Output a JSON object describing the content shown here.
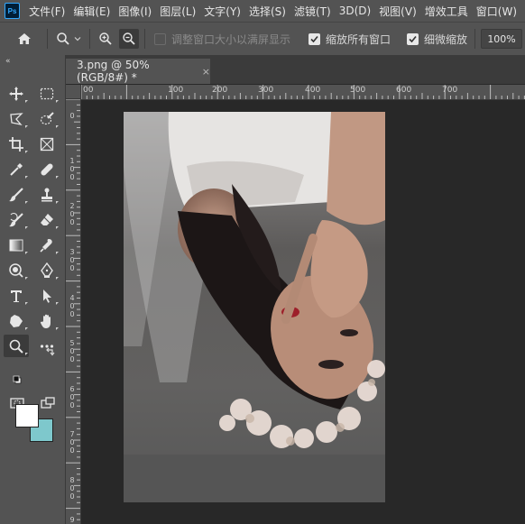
{
  "app": {
    "logo_text": "Ps"
  },
  "menu": [
    "文件(F)",
    "编辑(E)",
    "图像(I)",
    "图层(L)",
    "文字(Y)",
    "选择(S)",
    "滤镜(T)",
    "3D(D)",
    "视图(V)",
    "增效工具",
    "窗口(W)"
  ],
  "options": {
    "resize_windows_label": "调整窗口大小以满屏显示",
    "zoom_all_label": "缩放所有窗口",
    "scrubby_zoom_label": "细微缩放",
    "zoom_value": "100%"
  },
  "document": {
    "tab_title": "3.png @ 50%(RGB/8#) *",
    "close_glyph": "×"
  },
  "ruler": {
    "h_labels": [
      "00",
      "100",
      "200",
      "300",
      "400",
      "500",
      "600",
      "700"
    ],
    "v_labels": [
      "0",
      "1 0 0",
      "2 0 0",
      "3 0 0",
      "4 0 0",
      "5 0 0",
      "6 0 0",
      "7 0 0",
      "8 0 0",
      "9"
    ]
  },
  "colors": {
    "foreground": "#ffffff",
    "background": "#7ec8cc"
  },
  "tools": [
    "move-tool-icon",
    "marquee-tool-icon",
    "lasso-tool-icon",
    "quick-select-tool-icon",
    "crop-tool-icon",
    "frame-tool-icon",
    "eyedropper-tool-icon",
    "healing-brush-icon",
    "brush-tool-icon",
    "clone-stamp-icon",
    "history-brush-icon",
    "eraser-tool-icon",
    "gradient-tool-icon",
    "smudge-tool-icon",
    "dodge-tool-icon",
    "pen-tool-icon",
    "type-tool-icon",
    "path-select-icon",
    "shape-tool-icon",
    "hand-tool-icon",
    "zoom-tool-icon",
    "more-tools-icon"
  ]
}
